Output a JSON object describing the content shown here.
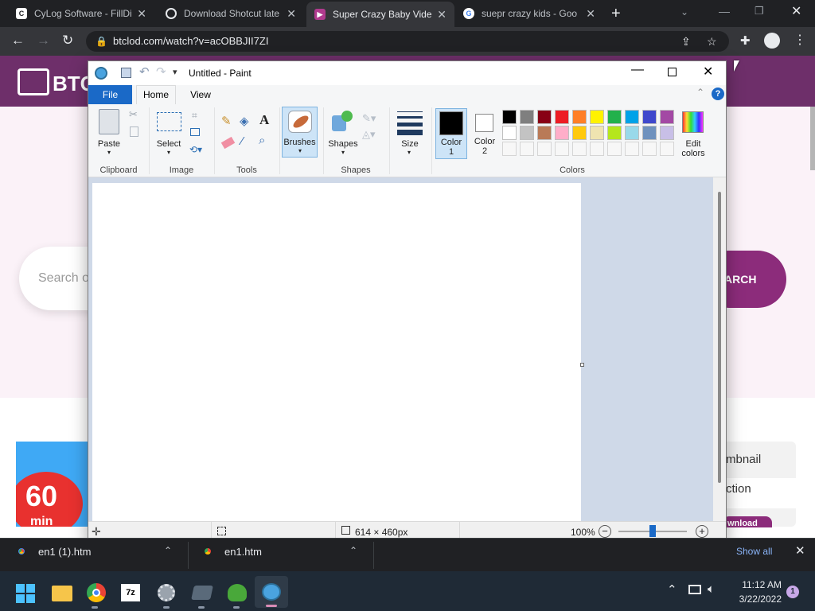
{
  "browser": {
    "tabs": [
      {
        "title": "CyLog Software - FillDi",
        "favicon": "cylog-icon"
      },
      {
        "title": "Download Shotcut late",
        "favicon": "shotcut-icon"
      },
      {
        "title": "Super Crazy Baby Vide",
        "favicon": "btclod-icon",
        "active": true
      },
      {
        "title": "suepr crazy kids - Goo",
        "favicon": "google-icon"
      }
    ],
    "url": "btclod.com/watch?v=acOBBJII7ZI"
  },
  "site": {
    "logo_text": "BTC",
    "search_placeholder": "Search o",
    "search_button": "ARCH",
    "thumb_badge_number": "60",
    "thumb_badge_unit": "min",
    "side_tab_1": "mbnail",
    "side_tab_2": "ction",
    "side_button": "wnload"
  },
  "paint": {
    "title": "Untitled - Paint",
    "menu": {
      "file": "File",
      "home": "Home",
      "view": "View"
    },
    "ribbon": {
      "paste": "Paste",
      "select": "Select",
      "brushes": "Brushes",
      "shapes": "Shapes",
      "size": "Size",
      "color1": "Color\n1",
      "color1_line1": "Color",
      "color1_line2": "1",
      "color2_line1": "Color",
      "color2_line2": "2",
      "edit_colors_line1": "Edit",
      "edit_colors_line2": "colors"
    },
    "groups": {
      "clipboard": "Clipboard",
      "image": "Image",
      "tools": "Tools",
      "shapes": "Shapes",
      "colors": "Colors"
    },
    "palette_row1": [
      "#000000",
      "#7f7f7f",
      "#880015",
      "#ed1c24",
      "#ff7f27",
      "#fff200",
      "#22b14c",
      "#00a2e8",
      "#3f48cc",
      "#a349a4"
    ],
    "palette_row2": [
      "#ffffff",
      "#c3c3c3",
      "#b97a57",
      "#ffaec9",
      "#ffc90e",
      "#efe4b0",
      "#b5e61d",
      "#99d9ea",
      "#7092be",
      "#c8bfe7"
    ],
    "status": {
      "canvas_size": "614 × 460px",
      "zoom": "100%"
    }
  },
  "downloads": {
    "items": [
      {
        "name": "en1 (1).htm"
      },
      {
        "name": "en1.htm"
      }
    ],
    "show_all": "Show all"
  },
  "taskbar": {
    "time": "11:12 AM",
    "date": "3/22/2022",
    "notification_count": "1",
    "apps": [
      "start-icon",
      "file-explorer-icon",
      "chrome-icon",
      "7zip-icon",
      "settings-gear-icon",
      "snipping-tool-icon",
      "frog-app-icon",
      "paint-icon"
    ]
  }
}
